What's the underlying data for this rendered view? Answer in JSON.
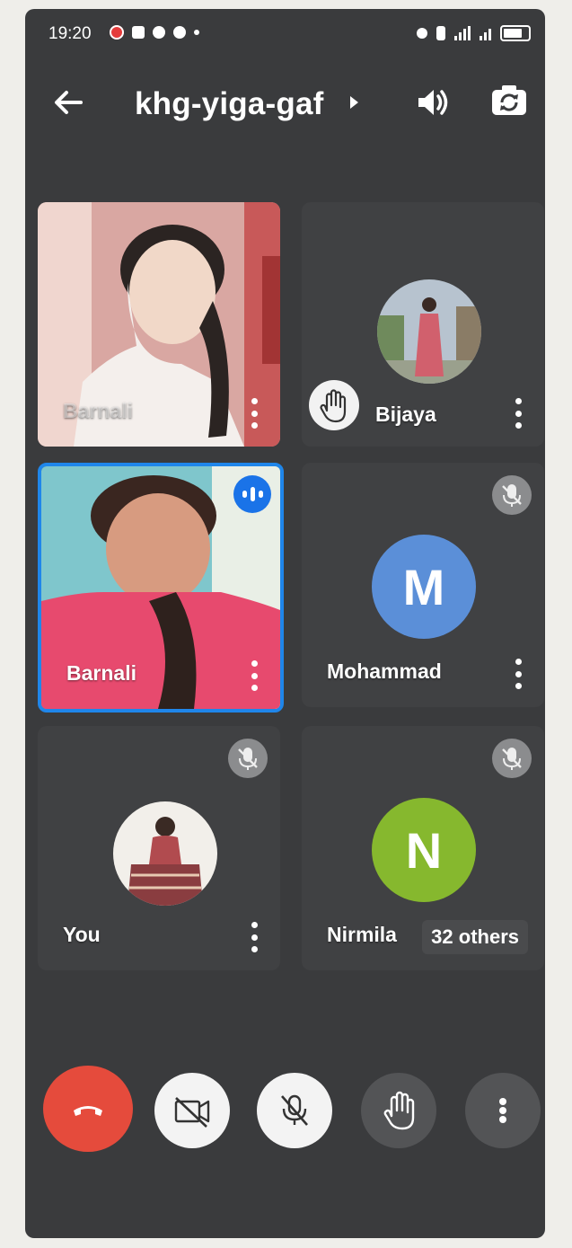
{
  "status_bar": {
    "time": "19:20",
    "icons": [
      "record-icon",
      "video-icon",
      "settings-icon",
      "whatsapp-icon",
      "dot-icon",
      "alarm-icon",
      "vibrate-icon",
      "signal-icon",
      "battery-icon"
    ]
  },
  "top_bar": {
    "meeting_code": "khg-yiga-gaf",
    "back_icon": "arrow-back-icon",
    "speaker_icon": "speaker-icon",
    "switch_camera_icon": "switch-camera-icon"
  },
  "participants": [
    {
      "name": "Barnali",
      "status": "video"
    },
    {
      "name": "Bijaya",
      "status": "hand-raised"
    },
    {
      "name": "Barnali",
      "status": "speaking"
    },
    {
      "name": "Mohammad",
      "initial": "M",
      "status": "muted"
    },
    {
      "name": "You",
      "status": "muted"
    },
    {
      "name": "Nirmila",
      "initial": "N",
      "status": "muted"
    }
  ],
  "others_label": "32 others",
  "colors": {
    "background": "#3a3b3d",
    "speaking_border": "#1f86ea",
    "avatar_m": "#5b8fd8",
    "avatar_n": "#86b82e",
    "end_call": "#e54b3c"
  },
  "controls": [
    "end-call-icon",
    "camera-off-icon",
    "mic-off-icon",
    "raise-hand-icon",
    "more-options-icon"
  ]
}
